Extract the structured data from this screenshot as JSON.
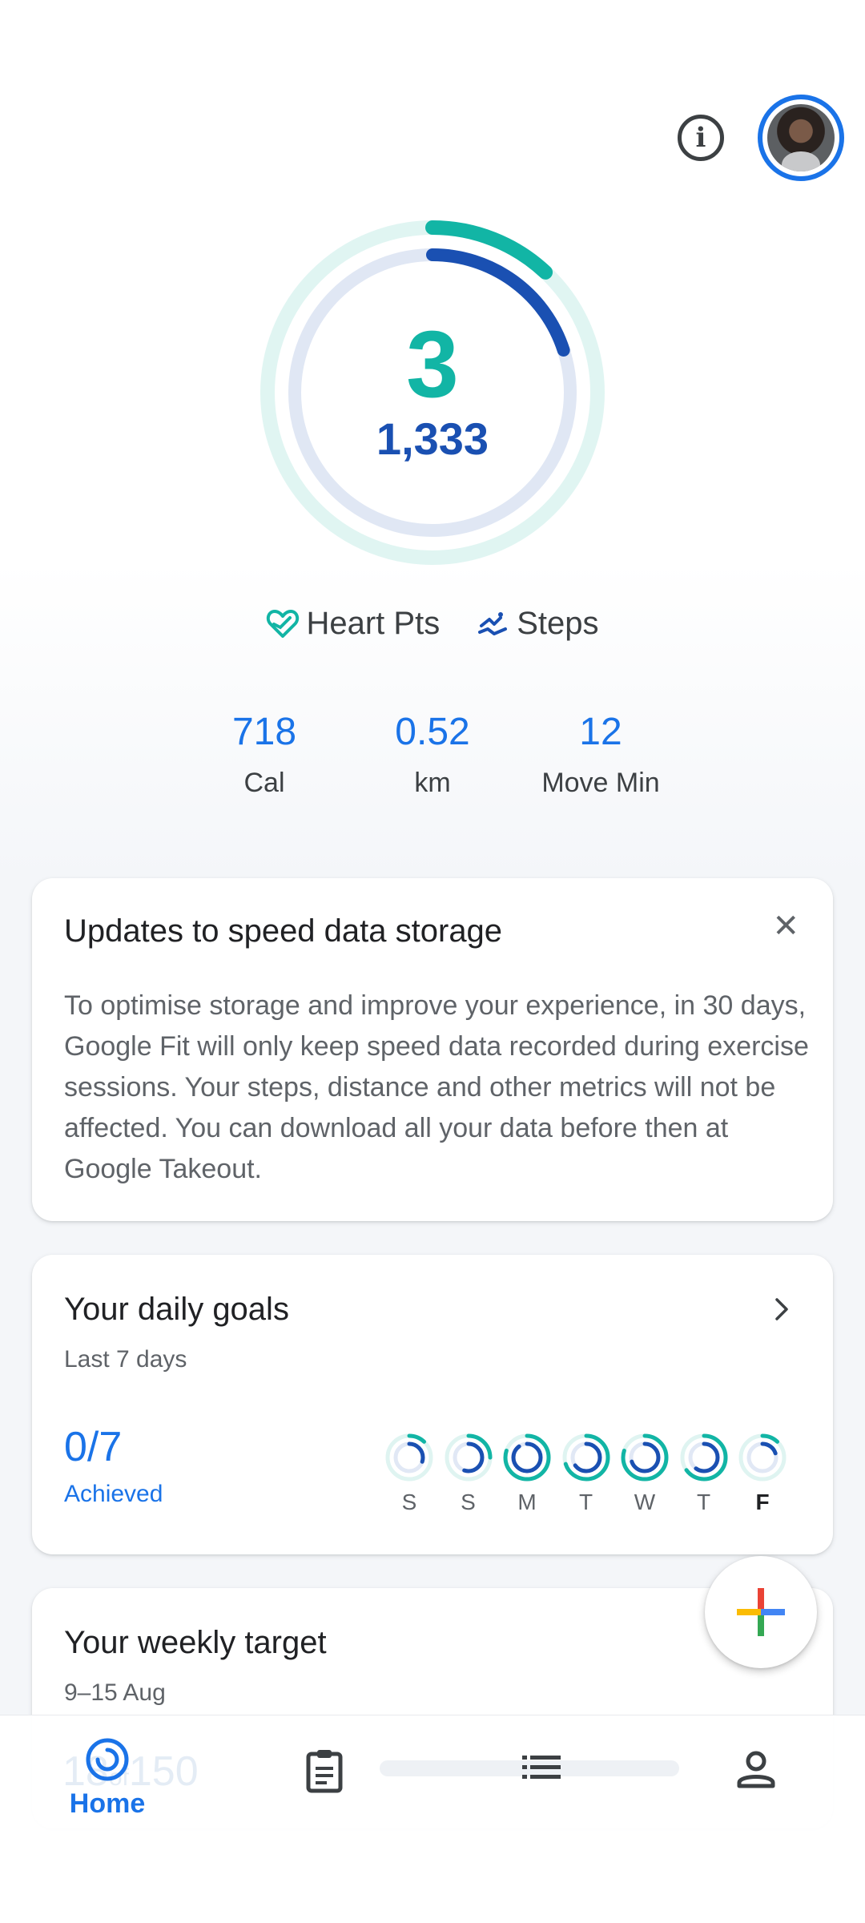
{
  "header": {
    "info_icon": "info-icon",
    "avatar_icon": "user-avatar"
  },
  "rings": {
    "heart_points": "3",
    "steps": "1,333",
    "heart_progress": 0.12,
    "steps_progress": 0.2,
    "heart_color": "#12b5a5",
    "steps_color": "#1a50b2"
  },
  "legend": {
    "heart_label": "Heart Pts",
    "steps_label": "Steps"
  },
  "stats": [
    {
      "value": "718",
      "label": "Cal"
    },
    {
      "value": "0.52",
      "label": "km"
    },
    {
      "value": "12",
      "label": "Move Min"
    }
  ],
  "update_card": {
    "title": "Updates to speed data storage",
    "body": "To optimise storage and improve your experience, in 30 days, Google Fit will only keep speed data recorded during exercise sessions. Your steps, distance and other metrics will not be affected. You can download all your data before then at Google Takeout."
  },
  "goals_card": {
    "title": "Your daily goals",
    "subtitle": "Last 7 days",
    "achieved_value": "0/7",
    "achieved_label": "Achieved",
    "days": [
      {
        "label": "S",
        "heart": 0.12,
        "steps": 0.3
      },
      {
        "label": "S",
        "heart": 0.25,
        "steps": 0.55
      },
      {
        "label": "M",
        "heart": 0.8,
        "steps": 0.9
      },
      {
        "label": "T",
        "heart": 0.7,
        "steps": 0.65
      },
      {
        "label": "W",
        "heart": 0.8,
        "steps": 0.7
      },
      {
        "label": "T",
        "heart": 0.65,
        "steps": 0.6
      },
      {
        "label": "F",
        "heart": 0.12,
        "steps": 0.2
      }
    ]
  },
  "weekly_card": {
    "title": "Your weekly target",
    "date_range": "9–15 Aug",
    "progress_value": "18",
    "progress_of": "of",
    "progress_target": "150"
  },
  "bottom_nav": {
    "home_label": "Home"
  }
}
